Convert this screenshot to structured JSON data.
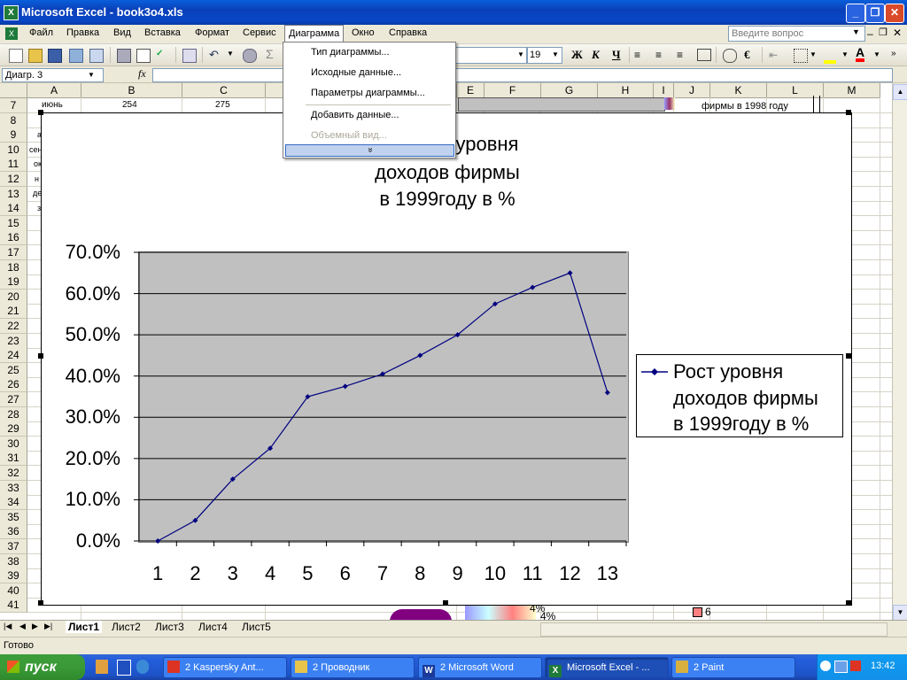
{
  "window": {
    "title": "Microsoft Excel - book3o4.xls"
  },
  "menu": {
    "items": [
      "Файл",
      "Правка",
      "Вид",
      "Вставка",
      "Формат",
      "Сервис",
      "Диаграмма",
      "Окно",
      "Справка"
    ],
    "help_placeholder": "Введите вопрос"
  },
  "toolbar": {
    "font_size": "19",
    "bold": "Ж",
    "italic": "К",
    "underline": "Ч",
    "euro": "€",
    "text_color_icon": "A"
  },
  "formula": {
    "name_box": "Диагр. 3",
    "fx": "fx"
  },
  "grid": {
    "columns": [
      "A",
      "B",
      "C",
      "D",
      "E",
      "F",
      "G",
      "H",
      "I",
      "J",
      "K",
      "L",
      "M"
    ],
    "rows": [
      "7",
      "8",
      "9",
      "10",
      "11",
      "12",
      "13",
      "14",
      "15",
      "16",
      "17",
      "18",
      "19",
      "20",
      "21",
      "22",
      "23",
      "24",
      "25",
      "26",
      "27",
      "28",
      "29",
      "30",
      "31",
      "32",
      "33",
      "34",
      "35",
      "36",
      "37",
      "38",
      "39",
      "40",
      "41"
    ],
    "row7": {
      "a": "июнь",
      "b": "254",
      "c": "275",
      "k": "фирмы в 1998 году"
    },
    "left_fragments": [
      "а",
      "сен",
      "ок",
      "н",
      "де",
      "з"
    ],
    "pie_labels": [
      "4%",
      "4%"
    ],
    "legend_fragment": "6"
  },
  "chart_menu": {
    "items": [
      "Тип диаграммы...",
      "Исходные данные...",
      "Параметры диаграммы...",
      "Добавить данные...",
      "Объемный вид..."
    ],
    "expand_glyph": "»"
  },
  "chart_title_visible": [
    "уровня",
    "доходов фирмы",
    "в 1999году в %"
  ],
  "chart_data": {
    "type": "line",
    "title": "Рост уровня доходов фирмы в 1999году в %",
    "categories": [
      "1",
      "2",
      "3",
      "4",
      "5",
      "6",
      "7",
      "8",
      "9",
      "10",
      "11",
      "12",
      "13"
    ],
    "series": [
      {
        "name": "Рост уровня доходов фирмы в 1999году в %",
        "values": [
          0.0,
          5.0,
          15.0,
          22.5,
          35.0,
          37.5,
          40.5,
          45.0,
          50.0,
          57.5,
          61.5,
          65.0,
          36.0
        ]
      }
    ],
    "y_ticks": [
      "0.0%",
      "10.0%",
      "20.0%",
      "30.0%",
      "40.0%",
      "50.0%",
      "60.0%",
      "70.0%"
    ],
    "ylim": [
      0,
      70
    ],
    "grid": true,
    "legend_position": "right",
    "legend_lines": [
      "Рост уровня",
      "доходов фирмы",
      "в 1999году в %"
    ],
    "colors": {
      "line": "#000080",
      "plot_bg": "#c0c0c0"
    }
  },
  "sheets": [
    "Лист1",
    "Лист2",
    "Лист3",
    "Лист4",
    "Лист5"
  ],
  "status": {
    "text": "Готово"
  },
  "taskbar": {
    "start_label": "пуск",
    "tasks": [
      "2 Kaspersky Ant...",
      "2 Проводник",
      "2 Microsoft Word",
      "Microsoft Excel - ...",
      "2 Paint"
    ],
    "clock": "13:42"
  }
}
